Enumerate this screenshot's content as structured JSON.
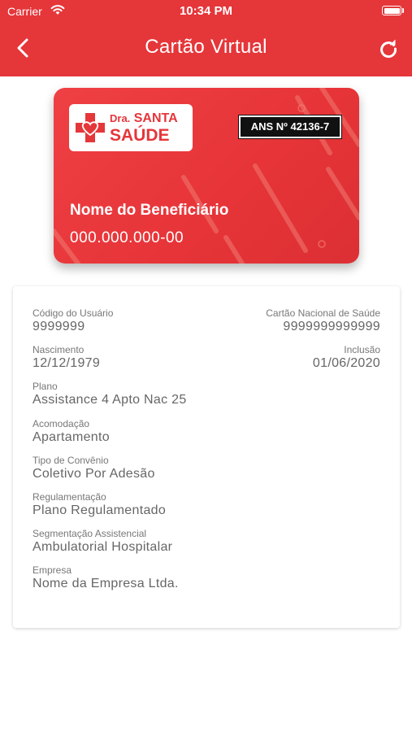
{
  "status_bar": {
    "carrier": "Carrier",
    "time": "10:34 PM"
  },
  "nav": {
    "title": "Cartão Virtual",
    "back_icon": "chevron-left-icon",
    "refresh_icon": "refresh-icon"
  },
  "card": {
    "logo": {
      "prefix": "Dra.",
      "line1": "SANTA",
      "line2": "SAÚDE"
    },
    "ans": "ANS Nº 42136-7",
    "holder_name": "Nome do Beneficiário",
    "document": "000.000.000-00"
  },
  "details": {
    "codigo_usuario": {
      "label": "Código do Usuário",
      "value": "9999999"
    },
    "cartao_nacional": {
      "label": "Cartão Nacional de Saúde",
      "value": "9999999999999"
    },
    "nascimento": {
      "label": "Nascimento",
      "value": "12/12/1979"
    },
    "inclusao": {
      "label": "Inclusão",
      "value": "01/06/2020"
    },
    "plano": {
      "label": "Plano",
      "value": "Assistance 4 Apto Nac 25"
    },
    "acomodacao": {
      "label": "Acomodação",
      "value": "Apartamento"
    },
    "tipo_convenio": {
      "label": "Tipo de Convênio",
      "value": "Coletivo Por Adesão"
    },
    "regulamentacao": {
      "label": "Regulamentação",
      "value": "Plano Regulamentado"
    },
    "segmentacao": {
      "label": "Segmentação Assistencial",
      "value": "Ambulatorial Hospitalar"
    },
    "empresa": {
      "label": "Empresa",
      "value": "Nome da Empresa Ltda."
    }
  },
  "colors": {
    "brand_red": "#e5363a",
    "label_gray": "#777777",
    "value_gray": "#666666"
  }
}
